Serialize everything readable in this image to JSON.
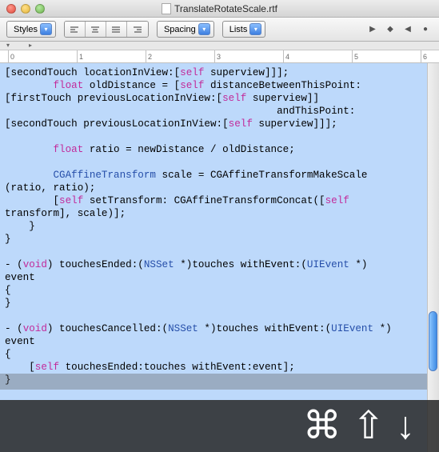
{
  "window": {
    "title": "TranslateRotateScale.rtf"
  },
  "toolbar": {
    "styles_label": "Styles",
    "spacing_label": "Spacing",
    "lists_label": "Lists"
  },
  "ruler": {
    "ticks": [
      "0",
      "1",
      "2",
      "3",
      "4",
      "5",
      "6"
    ]
  },
  "code": {
    "l1a": "[secondTouch locationInView:[",
    "l1b": "self",
    "l1c": " superview]]];",
    "l2a": "        ",
    "l2b": "float",
    "l2c": " oldDistance = [",
    "l2d": "self",
    "l2e": " distanceBetweenThisPoint:",
    "l3a": "[firstTouch previousLocationInView:[",
    "l3b": "self",
    "l3c": " superview]]",
    "l4": "                                             andThisPoint:",
    "l5a": "[secondTouch previousLocationInView:[",
    "l5b": "self",
    "l5c": " superview]]];",
    "l6": "",
    "l7a": "        ",
    "l7b": "float",
    "l7c": " ratio = newDistance / oldDistance;",
    "l8": "",
    "l9a": "        ",
    "l9b": "CGAffineTransform",
    "l9c": " scale = CGAffineTransformMakeScale",
    "l10": "(ratio, ratio);",
    "l11a": "        [",
    "l11b": "self",
    "l11c": " setTransform: CGAffineTransformConcat([",
    "l11d": "self",
    "l12": "transform], scale)];",
    "l13": "    }",
    "l14": "}",
    "l15": "",
    "l16a": "- (",
    "l16b": "void",
    "l16c": ") touchesEnded:(",
    "l16d": "NSSet",
    "l16e": " *)touches withEvent:(",
    "l16f": "UIEvent",
    "l16g": " *)",
    "l17": "event",
    "l18": "{",
    "l19": "}",
    "l20": "",
    "l21a": "- (",
    "l21b": "void",
    "l21c": ") touchesCancelled:(",
    "l21d": "NSSet",
    "l21e": " *)touches withEvent:(",
    "l21f": "UIEvent",
    "l21g": " *)",
    "l22": "event",
    "l23": "{",
    "l24a": "    [",
    "l24b": "self",
    "l24c": " touchesEnded:touches withEvent:event];",
    "l25": "}"
  },
  "shortcut": {
    "keys": [
      "command",
      "shift",
      "down-arrow"
    ]
  }
}
